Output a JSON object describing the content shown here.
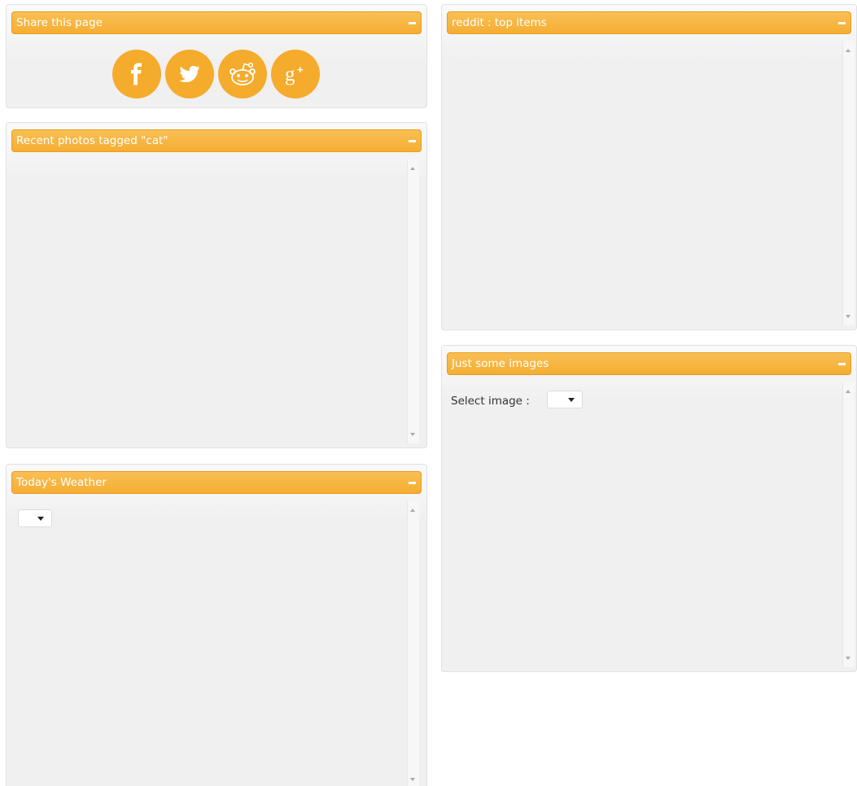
{
  "panels": {
    "share": {
      "title": "Share this page"
    },
    "cat_photos": {
      "title": "Recent photos tagged \"cat\""
    },
    "weather": {
      "title": "Today's Weather",
      "select_value": ""
    },
    "reddit": {
      "title": "reddit : top items"
    },
    "images": {
      "title": "Just some images",
      "select_label": "Select image :",
      "select_value": ""
    }
  },
  "share_buttons": [
    {
      "network": "Facebook",
      "icon": "facebook-icon"
    },
    {
      "network": "Twitter",
      "icon": "twitter-icon"
    },
    {
      "network": "reddit",
      "icon": "reddit-icon"
    },
    {
      "network": "Google+",
      "icon": "google-plus-icon",
      "glyph": "g+"
    }
  ],
  "colors": {
    "accent": "#f5ab2c",
    "header_border": "#e99d1c",
    "panel_bg": "#f0f0f0",
    "text_on_accent": "#ffffff"
  }
}
